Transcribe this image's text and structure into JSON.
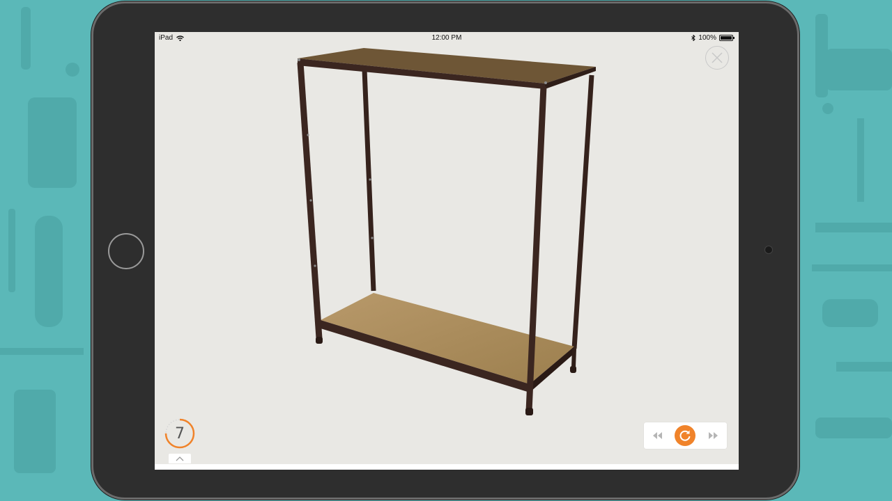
{
  "status_bar": {
    "device": "iPad",
    "time": "12:00 PM",
    "battery": "100%"
  },
  "icons": {
    "wifi": "wifi-icon",
    "bluetooth": "bluetooth-icon",
    "battery": "battery-icon",
    "close": "close-icon",
    "rewind": "rewind-icon",
    "replay": "replay-icon",
    "fast_forward": "fast-forward-icon",
    "expand": "chevron-up-icon"
  },
  "step": {
    "number": "7",
    "progress": 0.75
  },
  "colors": {
    "accent": "#f0832a",
    "frame_metal": "#3b2620",
    "shelf_board": "#a88a5a",
    "screen_bg": "#e9e8e4",
    "backdrop": "#5bb8b8"
  }
}
